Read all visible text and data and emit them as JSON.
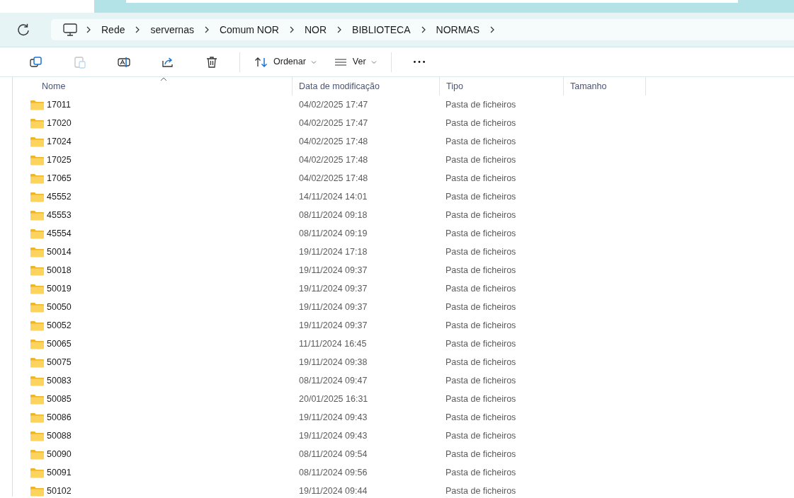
{
  "address": {
    "segments": [
      "Rede",
      "servernas",
      "Comum NOR",
      "NOR",
      "BIBLIOTECA",
      "NORMAS"
    ]
  },
  "toolbar": [
    {
      "kind": "copy",
      "disabled": false
    },
    {
      "kind": "paste",
      "disabled": true
    },
    {
      "kind": "rename",
      "disabled": false
    },
    {
      "kind": "share",
      "disabled": false
    },
    {
      "kind": "delete",
      "disabled": false
    },
    {
      "kind": "sort",
      "label": "Ordenar"
    },
    {
      "kind": "view",
      "label": "Ver"
    },
    {
      "kind": "more"
    }
  ],
  "table": {
    "columns": [
      {
        "label": "Nome",
        "sorted": true
      },
      {
        "label": "Data de modificação",
        "sorted": false
      },
      {
        "label": "Tipo",
        "sorted": false
      },
      {
        "label": "Tamanho",
        "sorted": false
      }
    ],
    "rows": [
      {
        "name": "17011",
        "modified": "04/02/2025 17:47",
        "type": "Pasta de ficheiros"
      },
      {
        "name": "17020",
        "modified": "04/02/2025 17:47",
        "type": "Pasta de ficheiros"
      },
      {
        "name": "17024",
        "modified": "04/02/2025 17:48",
        "type": "Pasta de ficheiros"
      },
      {
        "name": "17025",
        "modified": "04/02/2025 17:48",
        "type": "Pasta de ficheiros"
      },
      {
        "name": "17065",
        "modified": "04/02/2025 17:48",
        "type": "Pasta de ficheiros"
      },
      {
        "name": "45552",
        "modified": "14/11/2024 14:01",
        "type": "Pasta de ficheiros"
      },
      {
        "name": "45553",
        "modified": "08/11/2024 09:18",
        "type": "Pasta de ficheiros"
      },
      {
        "name": "45554",
        "modified": "08/11/2024 09:19",
        "type": "Pasta de ficheiros"
      },
      {
        "name": "50014",
        "modified": "19/11/2024 17:18",
        "type": "Pasta de ficheiros"
      },
      {
        "name": "50018",
        "modified": "19/11/2024 09:37",
        "type": "Pasta de ficheiros"
      },
      {
        "name": "50019",
        "modified": "19/11/2024 09:37",
        "type": "Pasta de ficheiros"
      },
      {
        "name": "50050",
        "modified": "19/11/2024 09:37",
        "type": "Pasta de ficheiros"
      },
      {
        "name": "50052",
        "modified": "19/11/2024 09:37",
        "type": "Pasta de ficheiros"
      },
      {
        "name": "50065",
        "modified": "11/11/2024 16:45",
        "type": "Pasta de ficheiros"
      },
      {
        "name": "50075",
        "modified": "19/11/2024 09:38",
        "type": "Pasta de ficheiros"
      },
      {
        "name": "50083",
        "modified": "08/11/2024 09:47",
        "type": "Pasta de ficheiros"
      },
      {
        "name": "50085",
        "modified": "20/01/2025 16:31",
        "type": "Pasta de ficheiros"
      },
      {
        "name": "50086",
        "modified": "19/11/2024 09:43",
        "type": "Pasta de ficheiros"
      },
      {
        "name": "50088",
        "modified": "19/11/2024 09:43",
        "type": "Pasta de ficheiros"
      },
      {
        "name": "50090",
        "modified": "08/11/2024 09:54",
        "type": "Pasta de ficheiros"
      },
      {
        "name": "50091",
        "modified": "08/11/2024 09:56",
        "type": "Pasta de ficheiros"
      },
      {
        "name": "50102",
        "modified": "19/11/2024 09:44",
        "type": "Pasta de ficheiros"
      }
    ]
  }
}
